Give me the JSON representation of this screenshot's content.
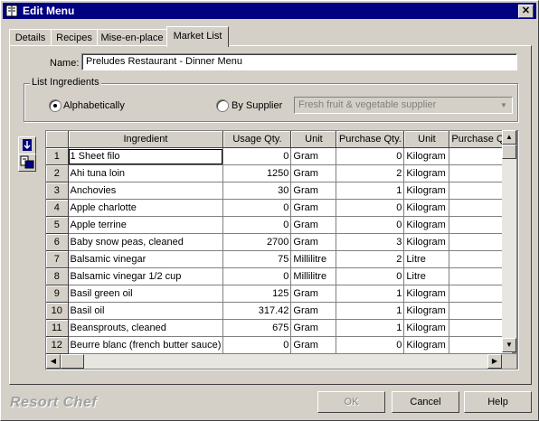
{
  "window": {
    "title": "Edit Menu"
  },
  "tabs": [
    {
      "label": "Details"
    },
    {
      "label": "Recipes"
    },
    {
      "label": "Mise-en-place"
    },
    {
      "label": "Market List"
    }
  ],
  "form": {
    "name_label": "Name:",
    "name_value": "Preludes Restaurant - Dinner Menu",
    "list_ingredients_label": "List Ingredients",
    "option_alpha": "Alphabetically",
    "option_supplier": "By Supplier",
    "selected_option": "Alphabetically",
    "supplier_value": "Fresh fruit & vegetable supplier"
  },
  "grid": {
    "columns": [
      "Ingredient",
      "Usage Qty.",
      "Unit",
      "Purchase Qty.",
      "Unit",
      "Purchase Qt"
    ],
    "rows": [
      {
        "n": "1",
        "ingredient": "1 Sheet filo",
        "usage": "0",
        "unit": "Gram",
        "pqty": "0",
        "punit": "Kilogram",
        "pq2": ""
      },
      {
        "n": "2",
        "ingredient": "Ahi tuna loin",
        "usage": "1250",
        "unit": "Gram",
        "pqty": "2",
        "punit": "Kilogram",
        "pq2": ""
      },
      {
        "n": "3",
        "ingredient": "Anchovies",
        "usage": "30",
        "unit": "Gram",
        "pqty": "1",
        "punit": "Kilogram",
        "pq2": ""
      },
      {
        "n": "4",
        "ingredient": "Apple charlotte",
        "usage": "0",
        "unit": "Gram",
        "pqty": "0",
        "punit": "Kilogram",
        "pq2": ""
      },
      {
        "n": "5",
        "ingredient": "Apple terrine",
        "usage": "0",
        "unit": "Gram",
        "pqty": "0",
        "punit": "Kilogram",
        "pq2": ""
      },
      {
        "n": "6",
        "ingredient": "Baby snow peas, cleaned",
        "usage": "2700",
        "unit": "Gram",
        "pqty": "3",
        "punit": "Kilogram",
        "pq2": ""
      },
      {
        "n": "7",
        "ingredient": "Balsamic vinegar",
        "usage": "75",
        "unit": "Millilitre",
        "pqty": "2",
        "punit": "Litre",
        "pq2": ""
      },
      {
        "n": "8",
        "ingredient": "Balsamic vinegar 1/2 cup",
        "usage": "0",
        "unit": "Millilitre",
        "pqty": "0",
        "punit": "Litre",
        "pq2": ""
      },
      {
        "n": "9",
        "ingredient": "Basil green oil",
        "usage": "125",
        "unit": "Gram",
        "pqty": "1",
        "punit": "Kilogram",
        "pq2": ""
      },
      {
        "n": "10",
        "ingredient": "Basil oil",
        "usage": "317.42",
        "unit": "Gram",
        "pqty": "1",
        "punit": "Kilogram",
        "pq2": ""
      },
      {
        "n": "11",
        "ingredient": "Beansprouts, cleaned",
        "usage": "675",
        "unit": "Gram",
        "pqty": "1",
        "punit": "Kilogram",
        "pq2": ""
      },
      {
        "n": "12",
        "ingredient": "Beurre blanc (french butter sauce)",
        "usage": "0",
        "unit": "Gram",
        "pqty": "0",
        "punit": "Kilogram",
        "pq2": ""
      }
    ]
  },
  "footer": {
    "logo": "Resort Chef",
    "ok_label": "OK",
    "cancel_label": "Cancel",
    "help_label": "Help"
  },
  "colors": {
    "titlebar": "#000080",
    "face": "#d4d0c8"
  }
}
